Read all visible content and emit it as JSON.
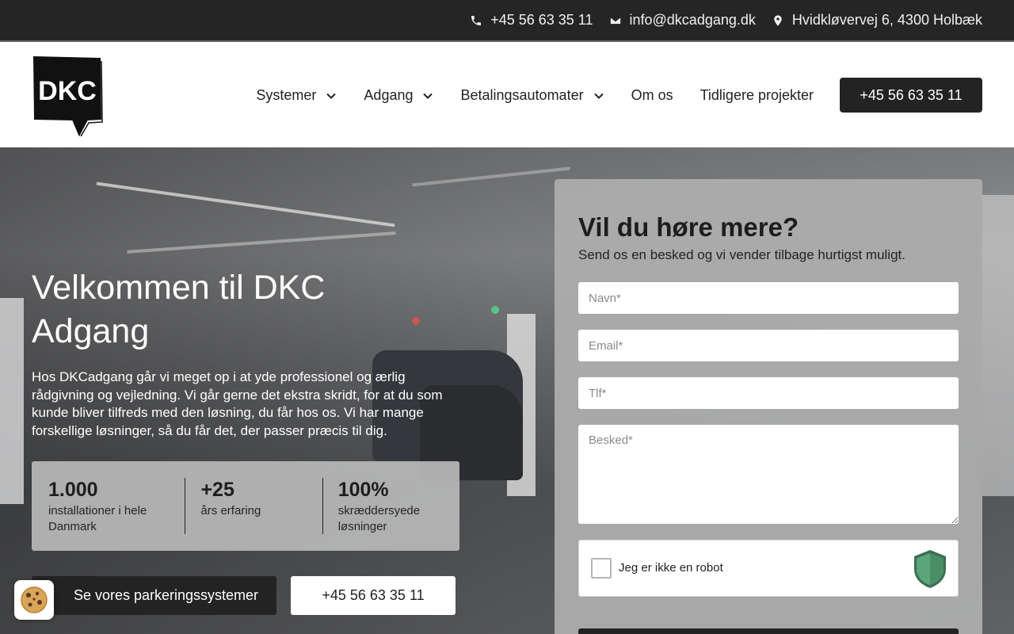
{
  "topbar": {
    "phone": "+45 56 63 35 11",
    "email": "info@dkcadgang.dk",
    "address": "Hvidkløvervej 6, 4300 Holbæk"
  },
  "header": {
    "logo_text": "DKC",
    "nav": [
      {
        "label": "Systemer",
        "has_dropdown": true
      },
      {
        "label": "Adgang",
        "has_dropdown": true
      },
      {
        "label": "Betalingsautomater",
        "has_dropdown": true
      },
      {
        "label": "Om os",
        "has_dropdown": false
      },
      {
        "label": "Tidligere projekter",
        "has_dropdown": false
      }
    ],
    "cta_phone": "+45 56 63 35 11"
  },
  "hero": {
    "title": "Velkommen til DKC Adgang",
    "text": "Hos DKCadgang går vi meget op i at yde professionel og ærlig rådgivning og vejledning. Vi går gerne det ekstra skridt, for at du som kunde bliver tilfreds med den løsning, du får hos os. Vi har mange forskellige løsninger, så du får det, der passer præcis til dig.",
    "stats": [
      {
        "value": "1.000",
        "label": "installationer i hele Danmark"
      },
      {
        "value": "+25",
        "label": "års erfaring"
      },
      {
        "value": "100%",
        "label": "skræddersyede løsninger"
      }
    ],
    "primary_button": "Se vores parkeringssystemer",
    "secondary_button": "+45 56 63 35 11"
  },
  "form": {
    "title": "Vil du høre mere?",
    "subtitle": "Send os en besked og vi vender tilbage hurtigst muligt.",
    "name_placeholder": "Navn*",
    "email_placeholder": "Email*",
    "phone_placeholder": "Tlf*",
    "message_placeholder": "Besked*",
    "captcha_label": "Jeg er ikke en robot"
  },
  "colors": {
    "dark": "#232323",
    "topbar": "#252525",
    "form_bg": "#acacac",
    "shield": "#4e9a6e"
  },
  "icons": [
    "phone-icon",
    "mail-icon",
    "map-pin-icon",
    "chevron-down-icon",
    "shield-icon",
    "cookie-icon"
  ]
}
